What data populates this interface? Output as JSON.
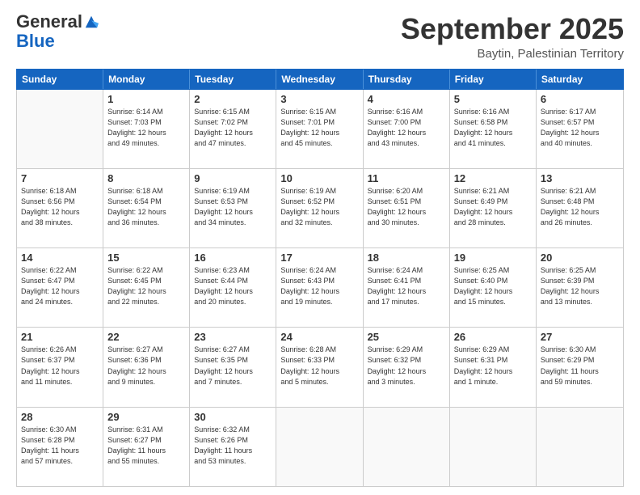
{
  "logo": {
    "general": "General",
    "blue": "Blue"
  },
  "title": "September 2025",
  "location": "Baytin, Palestinian Territory",
  "header_days": [
    "Sunday",
    "Monday",
    "Tuesday",
    "Wednesday",
    "Thursday",
    "Friday",
    "Saturday"
  ],
  "weeks": [
    [
      {
        "day": "",
        "info": ""
      },
      {
        "day": "1",
        "info": "Sunrise: 6:14 AM\nSunset: 7:03 PM\nDaylight: 12 hours\nand 49 minutes."
      },
      {
        "day": "2",
        "info": "Sunrise: 6:15 AM\nSunset: 7:02 PM\nDaylight: 12 hours\nand 47 minutes."
      },
      {
        "day": "3",
        "info": "Sunrise: 6:15 AM\nSunset: 7:01 PM\nDaylight: 12 hours\nand 45 minutes."
      },
      {
        "day": "4",
        "info": "Sunrise: 6:16 AM\nSunset: 7:00 PM\nDaylight: 12 hours\nand 43 minutes."
      },
      {
        "day": "5",
        "info": "Sunrise: 6:16 AM\nSunset: 6:58 PM\nDaylight: 12 hours\nand 41 minutes."
      },
      {
        "day": "6",
        "info": "Sunrise: 6:17 AM\nSunset: 6:57 PM\nDaylight: 12 hours\nand 40 minutes."
      }
    ],
    [
      {
        "day": "7",
        "info": "Sunrise: 6:18 AM\nSunset: 6:56 PM\nDaylight: 12 hours\nand 38 minutes."
      },
      {
        "day": "8",
        "info": "Sunrise: 6:18 AM\nSunset: 6:54 PM\nDaylight: 12 hours\nand 36 minutes."
      },
      {
        "day": "9",
        "info": "Sunrise: 6:19 AM\nSunset: 6:53 PM\nDaylight: 12 hours\nand 34 minutes."
      },
      {
        "day": "10",
        "info": "Sunrise: 6:19 AM\nSunset: 6:52 PM\nDaylight: 12 hours\nand 32 minutes."
      },
      {
        "day": "11",
        "info": "Sunrise: 6:20 AM\nSunset: 6:51 PM\nDaylight: 12 hours\nand 30 minutes."
      },
      {
        "day": "12",
        "info": "Sunrise: 6:21 AM\nSunset: 6:49 PM\nDaylight: 12 hours\nand 28 minutes."
      },
      {
        "day": "13",
        "info": "Sunrise: 6:21 AM\nSunset: 6:48 PM\nDaylight: 12 hours\nand 26 minutes."
      }
    ],
    [
      {
        "day": "14",
        "info": "Sunrise: 6:22 AM\nSunset: 6:47 PM\nDaylight: 12 hours\nand 24 minutes."
      },
      {
        "day": "15",
        "info": "Sunrise: 6:22 AM\nSunset: 6:45 PM\nDaylight: 12 hours\nand 22 minutes."
      },
      {
        "day": "16",
        "info": "Sunrise: 6:23 AM\nSunset: 6:44 PM\nDaylight: 12 hours\nand 20 minutes."
      },
      {
        "day": "17",
        "info": "Sunrise: 6:24 AM\nSunset: 6:43 PM\nDaylight: 12 hours\nand 19 minutes."
      },
      {
        "day": "18",
        "info": "Sunrise: 6:24 AM\nSunset: 6:41 PM\nDaylight: 12 hours\nand 17 minutes."
      },
      {
        "day": "19",
        "info": "Sunrise: 6:25 AM\nSunset: 6:40 PM\nDaylight: 12 hours\nand 15 minutes."
      },
      {
        "day": "20",
        "info": "Sunrise: 6:25 AM\nSunset: 6:39 PM\nDaylight: 12 hours\nand 13 minutes."
      }
    ],
    [
      {
        "day": "21",
        "info": "Sunrise: 6:26 AM\nSunset: 6:37 PM\nDaylight: 12 hours\nand 11 minutes."
      },
      {
        "day": "22",
        "info": "Sunrise: 6:27 AM\nSunset: 6:36 PM\nDaylight: 12 hours\nand 9 minutes."
      },
      {
        "day": "23",
        "info": "Sunrise: 6:27 AM\nSunset: 6:35 PM\nDaylight: 12 hours\nand 7 minutes."
      },
      {
        "day": "24",
        "info": "Sunrise: 6:28 AM\nSunset: 6:33 PM\nDaylight: 12 hours\nand 5 minutes."
      },
      {
        "day": "25",
        "info": "Sunrise: 6:29 AM\nSunset: 6:32 PM\nDaylight: 12 hours\nand 3 minutes."
      },
      {
        "day": "26",
        "info": "Sunrise: 6:29 AM\nSunset: 6:31 PM\nDaylight: 12 hours\nand 1 minute."
      },
      {
        "day": "27",
        "info": "Sunrise: 6:30 AM\nSunset: 6:29 PM\nDaylight: 11 hours\nand 59 minutes."
      }
    ],
    [
      {
        "day": "28",
        "info": "Sunrise: 6:30 AM\nSunset: 6:28 PM\nDaylight: 11 hours\nand 57 minutes."
      },
      {
        "day": "29",
        "info": "Sunrise: 6:31 AM\nSunset: 6:27 PM\nDaylight: 11 hours\nand 55 minutes."
      },
      {
        "day": "30",
        "info": "Sunrise: 6:32 AM\nSunset: 6:26 PM\nDaylight: 11 hours\nand 53 minutes."
      },
      {
        "day": "",
        "info": ""
      },
      {
        "day": "",
        "info": ""
      },
      {
        "day": "",
        "info": ""
      },
      {
        "day": "",
        "info": ""
      }
    ]
  ]
}
